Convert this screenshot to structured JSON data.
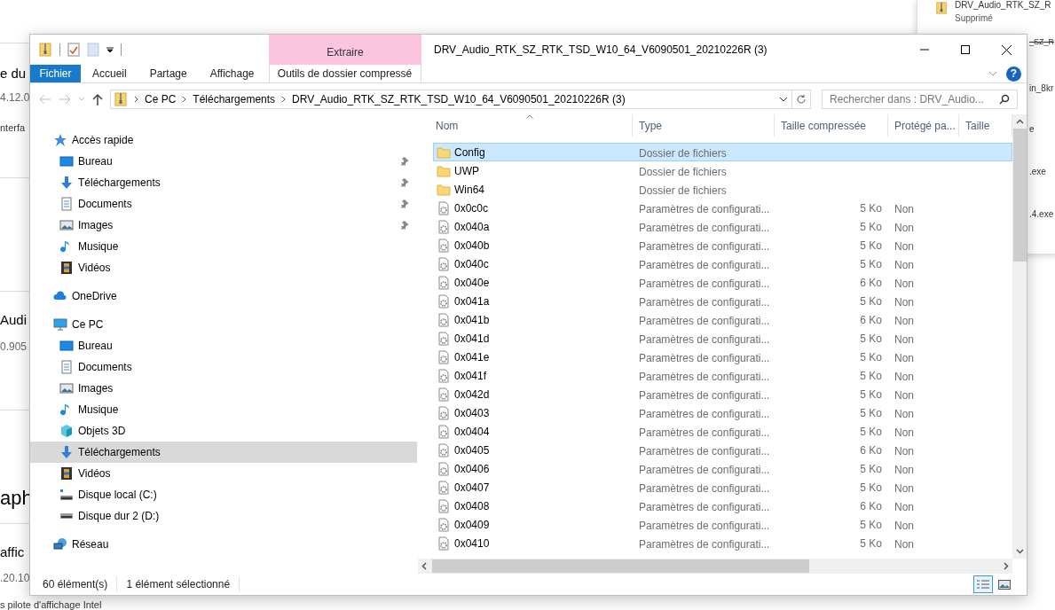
{
  "background_page": {
    "left_texts": [
      {
        "text": "e du",
        "kind": "heading"
      },
      {
        "text": "4.12.0",
        "kind": "version"
      },
      {
        "text": "nterfa",
        "kind": "body"
      },
      {
        "text": "Audi",
        "kind": "heading"
      },
      {
        "text": "0.905",
        "kind": "version"
      },
      {
        "text": "aph",
        "kind": "title"
      },
      {
        "text": "affic",
        "kind": "heading"
      },
      {
        "text": ".20.10",
        "kind": "version"
      },
      {
        "text": "s pilote d'affichage Intel",
        "kind": "body"
      }
    ],
    "right_panel": {
      "items": [
        {
          "text": "DRV_Audio_RTK_SZ_R",
          "kind": "file"
        },
        {
          "text": "Supprimé",
          "kind": "status"
        },
        {
          "text": "_SZ_R",
          "kind": "struck"
        },
        {
          "text": "in_8kr",
          "kind": "name"
        },
        {
          "text": "e",
          "kind": "name"
        },
        {
          "text": ".exe",
          "kind": "name"
        },
        {
          "text": ".4.exe",
          "kind": "name"
        }
      ]
    }
  },
  "help_button": "?",
  "window": {
    "title": "DRV_Audio_RTK_SZ_RTK_TSD_W10_64_V6090501_20210226R (3)",
    "contextual_group": "Extraire"
  },
  "ribbon_tabs": [
    {
      "label": "Fichier",
      "kind": "file"
    },
    {
      "label": "Accueil",
      "kind": "normal"
    },
    {
      "label": "Partage",
      "kind": "normal"
    },
    {
      "label": "Affichage",
      "kind": "normal"
    },
    {
      "label": "Outils de dossier compressé",
      "kind": "contextual"
    }
  ],
  "address_bar": {
    "path": [
      "Ce PC",
      "Téléchargements",
      "DRV_Audio_RTK_SZ_RTK_TSD_W10_64_V6090501_20210226R (3)"
    ]
  },
  "search": {
    "placeholder": "Rechercher dans : DRV_Audio..."
  },
  "nav_pane": [
    {
      "label": "Accès rapide",
      "kind": "star",
      "selected": false,
      "children": [
        {
          "label": "Bureau",
          "kind": "desktop",
          "pinned": true,
          "selected": false
        },
        {
          "label": "Téléchargements",
          "kind": "download",
          "pinned": true,
          "selected": false
        },
        {
          "label": "Documents",
          "kind": "document",
          "pinned": true,
          "selected": false
        },
        {
          "label": "Images",
          "kind": "image",
          "pinned": true,
          "selected": false
        },
        {
          "label": "Musique",
          "kind": "music",
          "pinned": false,
          "selected": false
        },
        {
          "label": "Vidéos",
          "kind": "video",
          "pinned": false,
          "selected": false
        }
      ]
    },
    {
      "label": "OneDrive",
      "kind": "cloud",
      "selected": false
    },
    {
      "label": "Ce PC",
      "kind": "computer",
      "selected": false,
      "children": [
        {
          "label": "Bureau",
          "kind": "desktop",
          "pinned": false,
          "selected": false
        },
        {
          "label": "Documents",
          "kind": "document",
          "pinned": false,
          "selected": false
        },
        {
          "label": "Images",
          "kind": "image",
          "pinned": false,
          "selected": false
        },
        {
          "label": "Musique",
          "kind": "music",
          "pinned": false,
          "selected": false
        },
        {
          "label": "Objets 3D",
          "kind": "cube",
          "pinned": false,
          "selected": false
        },
        {
          "label": "Téléchargements",
          "kind": "download",
          "pinned": false,
          "selected": true
        },
        {
          "label": "Vidéos",
          "kind": "video",
          "pinned": false,
          "selected": false
        },
        {
          "label": "Disque local (C:)",
          "kind": "system-drive",
          "pinned": false,
          "selected": false
        },
        {
          "label": "Disque dur 2 (D:)",
          "kind": "drive",
          "pinned": false,
          "selected": false
        }
      ]
    },
    {
      "label": "Réseau",
      "kind": "network",
      "selected": false
    }
  ],
  "file_list": {
    "columns": [
      {
        "label": "Nom",
        "sorted": true
      },
      {
        "label": "Type",
        "sorted": false
      },
      {
        "label": "Taille compressée",
        "sorted": false
      },
      {
        "label": "Protégé pa...",
        "sorted": false
      },
      {
        "label": "Taille",
        "sorted": false
      }
    ],
    "rows": [
      {
        "name": "Config",
        "type": "Dossier de fichiers",
        "kind": "folder",
        "selected": true
      },
      {
        "name": "UWP",
        "type": "Dossier de fichiers",
        "kind": "folder",
        "selected": false
      },
      {
        "name": "Win64",
        "type": "Dossier de fichiers",
        "kind": "folder",
        "selected": false
      },
      {
        "name": "0x0c0c",
        "type": "Paramètres de configurati...",
        "compressed_size": "5 Ko",
        "protected": "Non",
        "kind": "config",
        "selected": false
      },
      {
        "name": "0x040a",
        "type": "Paramètres de configurati...",
        "compressed_size": "5 Ko",
        "protected": "Non",
        "kind": "config",
        "selected": false
      },
      {
        "name": "0x040b",
        "type": "Paramètres de configurati...",
        "compressed_size": "5 Ko",
        "protected": "Non",
        "kind": "config",
        "selected": false
      },
      {
        "name": "0x040c",
        "type": "Paramètres de configurati...",
        "compressed_size": "5 Ko",
        "protected": "Non",
        "kind": "config",
        "selected": false
      },
      {
        "name": "0x040e",
        "type": "Paramètres de configurati...",
        "compressed_size": "6 Ko",
        "protected": "Non",
        "kind": "config",
        "selected": false
      },
      {
        "name": "0x041a",
        "type": "Paramètres de configurati...",
        "compressed_size": "5 Ko",
        "protected": "Non",
        "kind": "config",
        "selected": false
      },
      {
        "name": "0x041b",
        "type": "Paramètres de configurati...",
        "compressed_size": "6 Ko",
        "protected": "Non",
        "kind": "config",
        "selected": false
      },
      {
        "name": "0x041d",
        "type": "Paramètres de configurati...",
        "compressed_size": "5 Ko",
        "protected": "Non",
        "kind": "config",
        "selected": false
      },
      {
        "name": "0x041e",
        "type": "Paramètres de configurati...",
        "compressed_size": "5 Ko",
        "protected": "Non",
        "kind": "config",
        "selected": false
      },
      {
        "name": "0x041f",
        "type": "Paramètres de configurati...",
        "compressed_size": "5 Ko",
        "protected": "Non",
        "kind": "config",
        "selected": false
      },
      {
        "name": "0x042d",
        "type": "Paramètres de configurati...",
        "compressed_size": "5 Ko",
        "protected": "Non",
        "kind": "config",
        "selected": false
      },
      {
        "name": "0x0403",
        "type": "Paramètres de configurati...",
        "compressed_size": "5 Ko",
        "protected": "Non",
        "kind": "config",
        "selected": false
      },
      {
        "name": "0x0404",
        "type": "Paramètres de configurati...",
        "compressed_size": "5 Ko",
        "protected": "Non",
        "kind": "config",
        "selected": false
      },
      {
        "name": "0x0405",
        "type": "Paramètres de configurati...",
        "compressed_size": "6 Ko",
        "protected": "Non",
        "kind": "config",
        "selected": false
      },
      {
        "name": "0x0406",
        "type": "Paramètres de configurati...",
        "compressed_size": "5 Ko",
        "protected": "Non",
        "kind": "config",
        "selected": false
      },
      {
        "name": "0x0407",
        "type": "Paramètres de configurati...",
        "compressed_size": "5 Ko",
        "protected": "Non",
        "kind": "config",
        "selected": false
      },
      {
        "name": "0x0408",
        "type": "Paramètres de configurati...",
        "compressed_size": "6 Ko",
        "protected": "Non",
        "kind": "config",
        "selected": false
      },
      {
        "name": "0x0409",
        "type": "Paramètres de configurati...",
        "compressed_size": "5 Ko",
        "protected": "Non",
        "kind": "config",
        "selected": false
      },
      {
        "name": "0x0410",
        "type": "Paramètres de configurati...",
        "compressed_size": "5 Ko",
        "protected": "Non",
        "kind": "config",
        "selected": false
      }
    ]
  },
  "status_bar": {
    "texts": [
      "60 élément(s)",
      "1 élément sélectionné"
    ],
    "view_buttons": [
      {
        "kind": "details",
        "selected": true
      },
      {
        "kind": "large-icons",
        "selected": false
      }
    ]
  }
}
